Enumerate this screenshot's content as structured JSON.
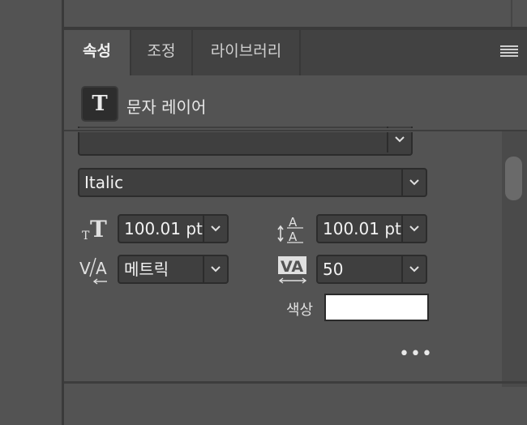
{
  "tabs": [
    {
      "label": "속성",
      "active": true
    },
    {
      "label": "조정",
      "active": false
    },
    {
      "label": "라이브러리",
      "active": false
    }
  ],
  "layer": {
    "icon_glyph": "T",
    "label": "문자 레이어"
  },
  "font_family": {
    "value": ""
  },
  "font_style": {
    "value": "Italic"
  },
  "font_size": {
    "value": "100.01 pt"
  },
  "leading": {
    "value": "100.01 pt"
  },
  "kerning": {
    "value": "메트릭"
  },
  "tracking": {
    "value": "50"
  },
  "color": {
    "label": "색상",
    "value": "#ffffff"
  },
  "more": {
    "label": "•••"
  },
  "icons": {
    "panel_menu": "hamburger-menu-icon",
    "font_size": "font-size-icon",
    "leading": "leading-icon",
    "kerning": "kerning-icon",
    "tracking": "tracking-icon"
  }
}
